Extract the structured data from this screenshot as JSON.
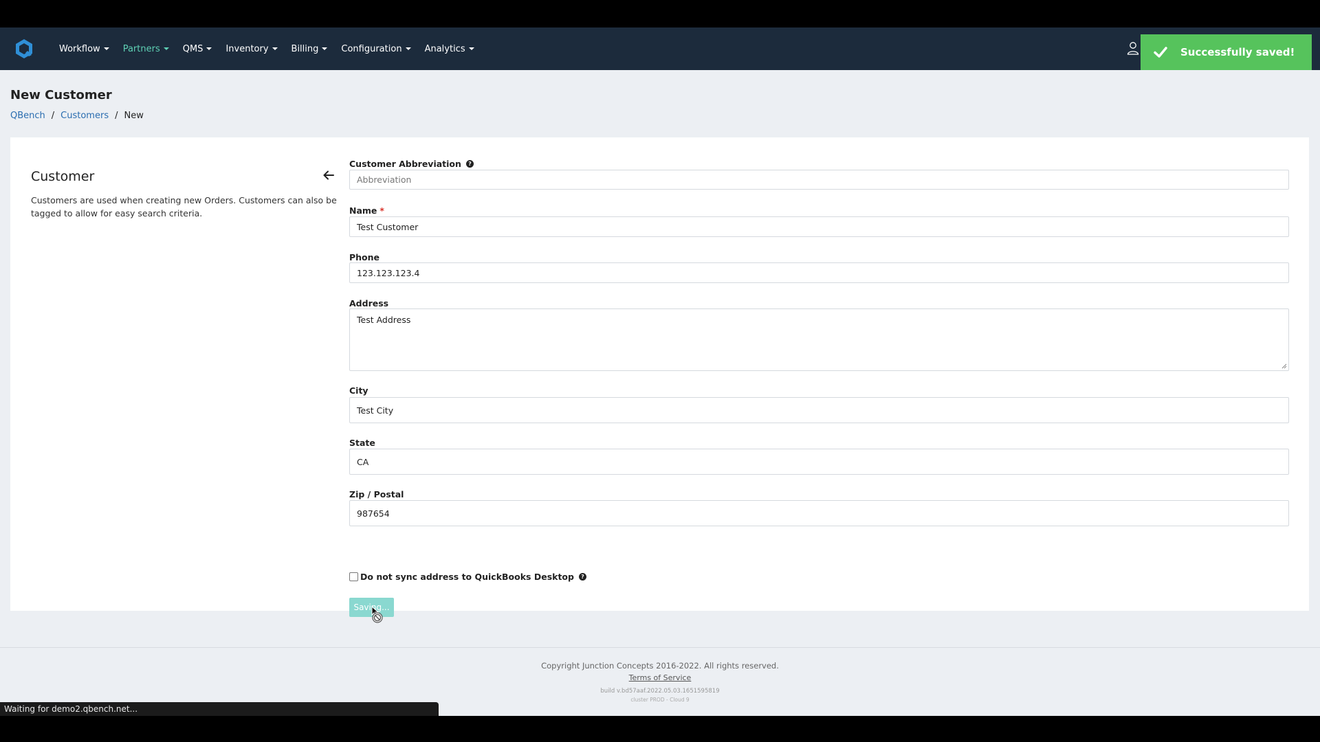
{
  "nav": {
    "items": [
      {
        "label": "Workflow",
        "active": false
      },
      {
        "label": "Partners",
        "active": true
      },
      {
        "label": "QMS",
        "active": false
      },
      {
        "label": "Inventory",
        "active": false
      },
      {
        "label": "Billing",
        "active": false
      },
      {
        "label": "Configuration",
        "active": false
      },
      {
        "label": "Analytics",
        "active": false
      }
    ],
    "accent_color": "#5ed0b4",
    "background": "#1c2b3c"
  },
  "toast": {
    "message": "Successfully saved!",
    "color": "#56c35c"
  },
  "page": {
    "title": "New Customer",
    "breadcrumb": [
      "QBench",
      "Customers",
      "New"
    ],
    "separator": "/"
  },
  "section": {
    "title": "Customer",
    "description": "Customers are used when creating new Orders. Customers can also be tagged to allow for easy search criteria."
  },
  "form": {
    "abbreviation": {
      "label": "Customer Abbreviation",
      "placeholder": "Abbreviation",
      "value": ""
    },
    "name": {
      "label": "Name",
      "required_mark": "*",
      "value": "Test Customer"
    },
    "phone": {
      "label": "Phone",
      "value": "123.123.123.4"
    },
    "address": {
      "label": "Address",
      "value": "Test Address"
    },
    "city": {
      "label": "City",
      "value": "Test City"
    },
    "state": {
      "label": "State",
      "value": "CA"
    },
    "zip": {
      "label": "Zip / Postal",
      "value": "987654"
    },
    "no_sync": {
      "label": "Do not sync address to QuickBooks Desktop",
      "checked": false
    },
    "save_label": "Saving..."
  },
  "footer": {
    "copyright": "Copyright Junction Concepts 2016-2022. All rights reserved.",
    "terms": "Terms of Service",
    "build": "build v.bd57aaf.2022.05.03.1651595819",
    "cluster": "cluster PROD - Cloud 9"
  },
  "statusbar": "Waiting for demo2.qbench.net..."
}
